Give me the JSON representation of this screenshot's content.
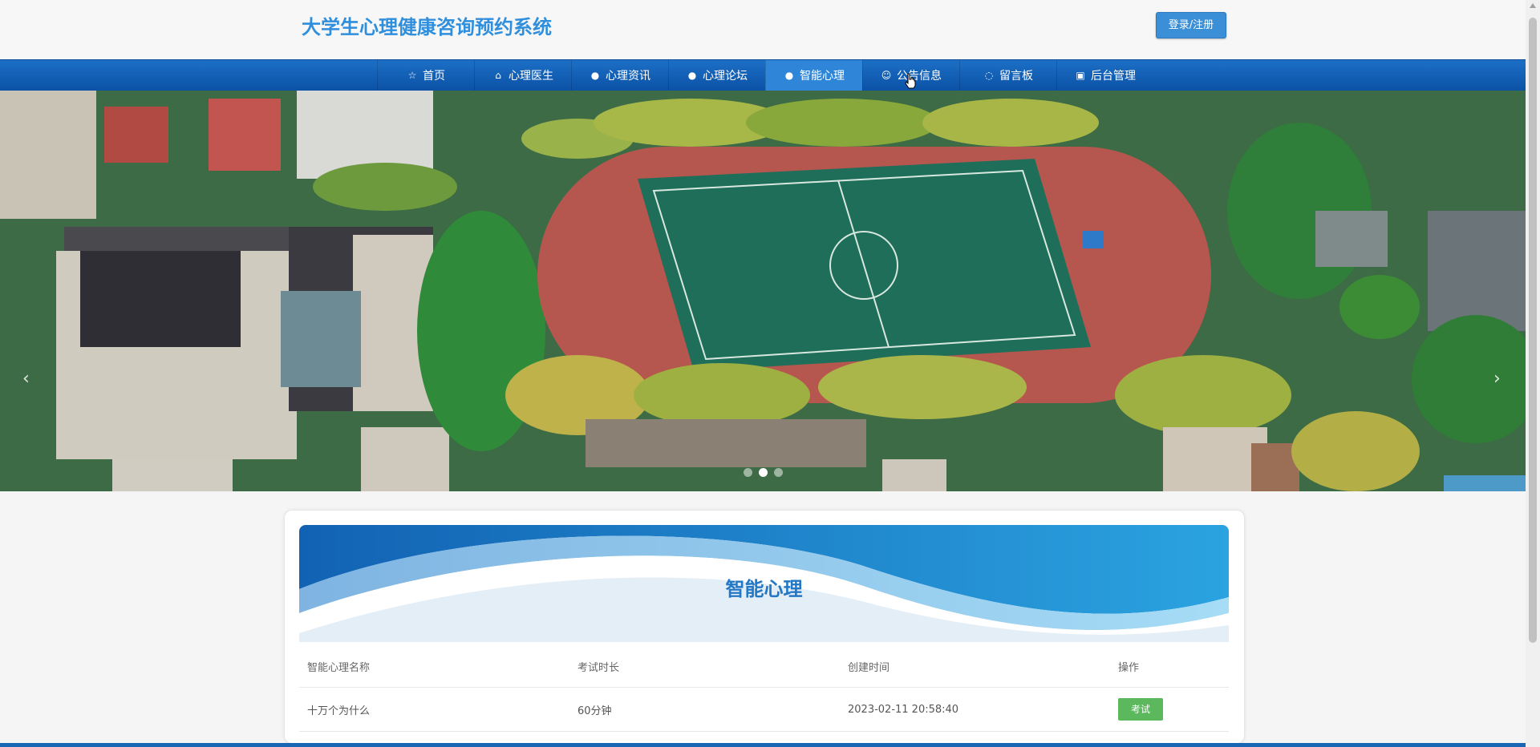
{
  "site": {
    "title": "大学生心理健康咨询预约系统",
    "login_label": "登录/注册"
  },
  "nav": {
    "items": [
      {
        "label": "首页",
        "icon": "star-icon"
      },
      {
        "label": "心理医生",
        "icon": "bag-icon"
      },
      {
        "label": "心理资讯",
        "icon": "info-icon"
      },
      {
        "label": "心理论坛",
        "icon": "question-icon"
      },
      {
        "label": "智能心理",
        "icon": "info-icon",
        "active": true
      },
      {
        "label": "公告信息",
        "icon": "smile-icon"
      },
      {
        "label": "留言板",
        "icon": "chat-icon"
      },
      {
        "label": "后台管理",
        "icon": "calendar-icon"
      }
    ]
  },
  "banner": {
    "slides": 3,
    "active_slide": 2
  },
  "section": {
    "title": "智能心理",
    "columns": [
      "智能心理名称",
      "考试时长",
      "创建时间",
      "操作"
    ],
    "rows": [
      {
        "name": "十万个为什么",
        "duration": "60分钟",
        "created": "2023-02-11 20:58:40",
        "action": "考试"
      }
    ]
  },
  "colors": {
    "brand_blue": "#2f8fdc",
    "nav_blue": "#0b52a6",
    "action_green": "#5cb85c"
  }
}
